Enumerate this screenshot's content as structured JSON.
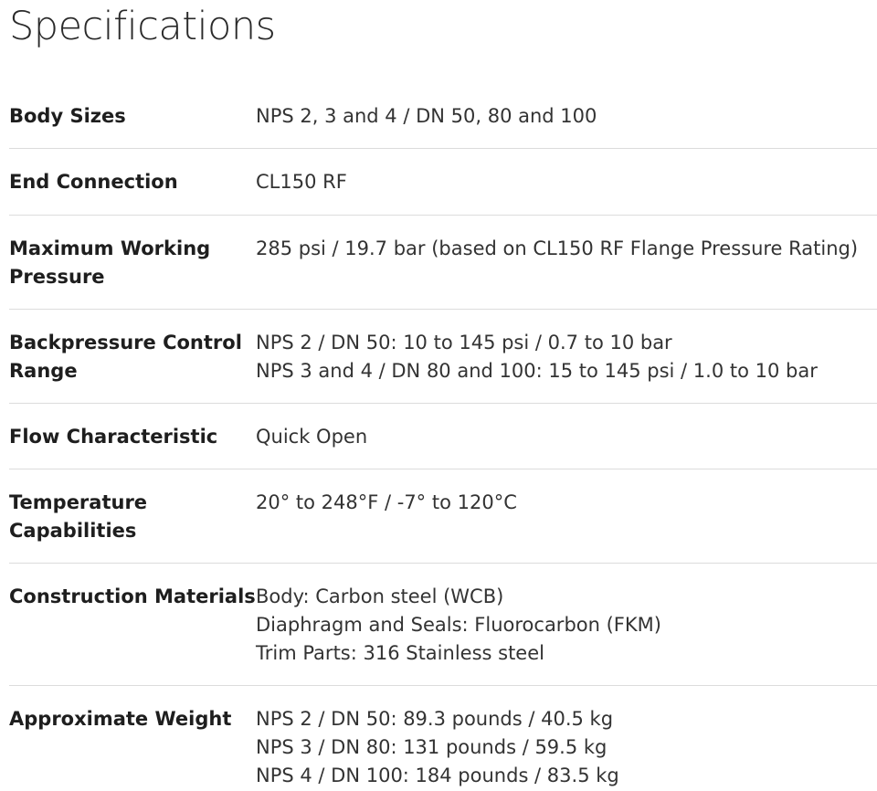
{
  "title": "Specifications",
  "rows": [
    {
      "label": "Body Sizes",
      "values": [
        "NPS 2, 3 and 4 / DN 50, 80 and 100"
      ]
    },
    {
      "label": "End Connection",
      "values": [
        "CL150 RF"
      ]
    },
    {
      "label": "Maximum Working Pressure",
      "values": [
        "285 psi / 19.7 bar (based on CL150 RF Flange Pressure Rating)"
      ]
    },
    {
      "label": "Backpressure Control Range",
      "values": [
        "NPS 2 / DN 50: 10 to 145 psi / 0.7 to 10 bar",
        "NPS 3 and 4 / DN 80 and 100: 15 to 145 psi / 1.0 to 10 bar"
      ]
    },
    {
      "label": "Flow Characteristic",
      "values": [
        "Quick Open"
      ]
    },
    {
      "label": "Temperature Capabilities",
      "values": [
        "20° to 248°F / -7° to 120°C"
      ]
    },
    {
      "label": "Construction Materials",
      "values": [
        "Body: Carbon steel (WCB)",
        "Diaphragm and Seals: Fluorocarbon (FKM)",
        "Trim Parts: 316 Stainless steel"
      ]
    },
    {
      "label": "Approximate Weight",
      "values": [
        "NPS 2 / DN 50: 89.3 pounds / 40.5 kg",
        "NPS 3 / DN 80: 131 pounds / 59.5 kg",
        "NPS 4 / DN 100: 184 pounds / 83.5 kg"
      ]
    }
  ]
}
